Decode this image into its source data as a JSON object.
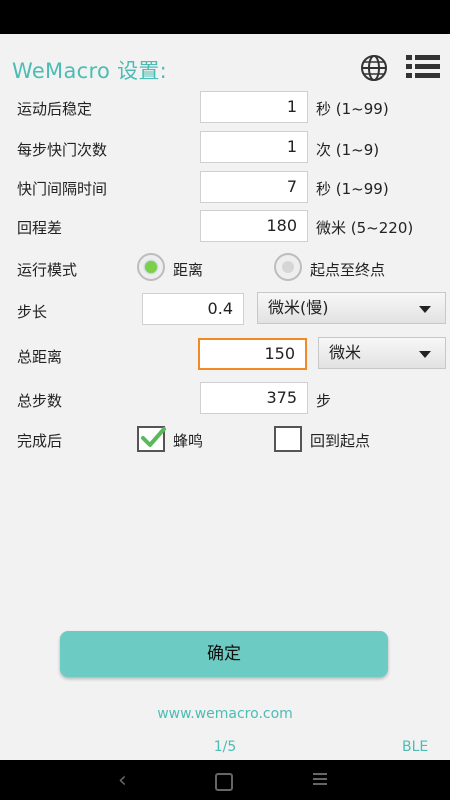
{
  "header": {
    "title": "WeMacro 设置:",
    "globe_icon": "globe-icon",
    "menu_icon": "list-menu-icon"
  },
  "settings": {
    "stabilize": {
      "label": "运动后稳定",
      "value": "1",
      "unit": "秒 (1~99)"
    },
    "shutter_count": {
      "label": "每步快门次数",
      "value": "1",
      "unit": "次 (1~9)"
    },
    "shutter_interval": {
      "label": "快门间隔时间",
      "value": "7",
      "unit": "秒 (1~99)"
    },
    "backlash": {
      "label": "回程差",
      "value": "180",
      "unit": "微米 (5~220)"
    },
    "run_mode": {
      "label": "运行模式",
      "option_distance": "距离",
      "option_start_end": "起点至终点",
      "selected": "距离"
    },
    "step": {
      "label": "步长",
      "value": "0.4",
      "unit_selected": "微米(慢)"
    },
    "total_distance": {
      "label": "总距离",
      "value": "150",
      "unit_selected": "微米"
    },
    "total_steps": {
      "label": "总步数",
      "value": "375",
      "unit": "步"
    },
    "after_finish": {
      "label": "完成后",
      "beep_label": "蜂鸣",
      "beep_checked": true,
      "return_label": "回到起点",
      "return_checked": false
    }
  },
  "confirm_label": "确定",
  "website": "www.wemacro.com",
  "page_indicator": "1/5",
  "ble_label": "BLE",
  "colors": {
    "accent": "#4bbdb4",
    "button": "#6ccbc2",
    "radio_on": "#7ccf47",
    "focus": "#f08a24"
  }
}
